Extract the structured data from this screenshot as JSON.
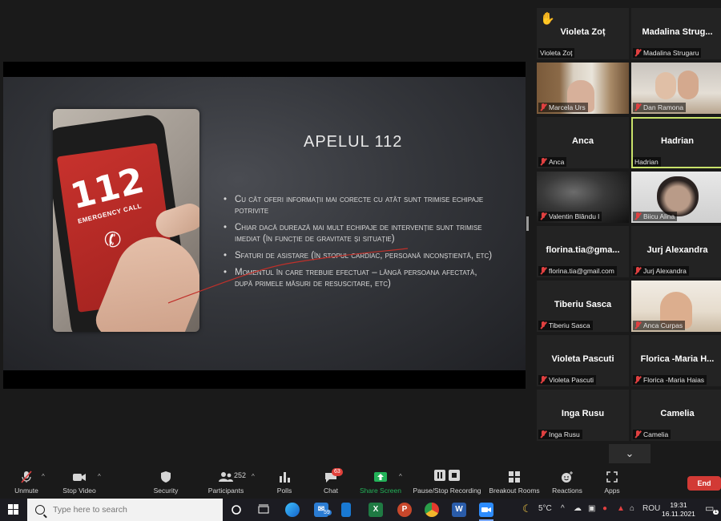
{
  "slide": {
    "title": "APELUL 112",
    "bullets": [
      "Cu cât oferi informații mai corecte cu atât sunt trimise echipaje potrivite",
      "Chiar dacă durează mai mult echipaje de intervenție sunt trimise imediat (în funcție de gravitate și situație)",
      "Sfaturi de asistare (în stopul cardiac, persoană inconștientă, etc)",
      "Momentul în care trebuie efectuat – lângă persoana afectată, după primele măsuri de resuscitare, etc)"
    ],
    "phone_number": "112",
    "phone_label": "EMERGENCY CALL"
  },
  "gallery": {
    "tiles": [
      {
        "name": "Violeta Zoț",
        "label": "Violeta Zoț",
        "muted": false,
        "hand_raised": true
      },
      {
        "name": "Madalina  Strug...",
        "label": "Madalina Strugaru",
        "muted": true
      },
      {
        "name": "",
        "label": "Marcela Urs",
        "muted": true,
        "video": true
      },
      {
        "name": "",
        "label": "Dan Ramona",
        "muted": true,
        "video": true
      },
      {
        "name": "Anca",
        "label": "Anca",
        "muted": true
      },
      {
        "name": "Hadrian",
        "label": "Hadrian",
        "muted": false,
        "active": true
      },
      {
        "name": "",
        "label": "Valentin Blându l",
        "muted": true,
        "video": true
      },
      {
        "name": "",
        "label": "Biicu Alina",
        "muted": true,
        "video": true
      },
      {
        "name": "florina.tia@gma...",
        "label": "florina.tia@gmail.com",
        "muted": true
      },
      {
        "name": "Jurj Alexandra",
        "label": "Jurj Alexandra",
        "muted": true
      },
      {
        "name": "Tiberiu Sasca",
        "label": "Tiberiu Sasca",
        "muted": true
      },
      {
        "name": "",
        "label": "Anca Curpas",
        "muted": true,
        "video": true
      },
      {
        "name": "Violeta Pascuti",
        "label": "Violeta Pascuti",
        "muted": true
      },
      {
        "name": "Florica  -Maria  H...",
        "label": "Florica -Maria Haias",
        "muted": true
      },
      {
        "name": "Inga Rusu",
        "label": "Inga Rusu",
        "muted": true
      },
      {
        "name": "Camelia",
        "label": "Camelia",
        "muted": true
      }
    ]
  },
  "toolbar": {
    "unmute": "Unmute",
    "stop_video": "Stop Video",
    "security": "Security",
    "participants": "Participants",
    "participants_count": "252",
    "polls": "Polls",
    "chat": "Chat",
    "chat_badge": "63",
    "share_screen": "Share Screen",
    "recording": "Pause/Stop Recording",
    "breakout": "Breakout Rooms",
    "reactions": "Reactions",
    "apps": "Apps",
    "end": "End"
  },
  "taskbar": {
    "search_placeholder": "Type here to search",
    "mail_badge": "59",
    "weather": "5°C",
    "language": "ROU",
    "time": "19:31",
    "date": "16.11.2021",
    "notification_count": "1"
  },
  "colors": {
    "accent_green": "#23b359",
    "end_red": "#d23a35",
    "active_speaker": "#c9e26a",
    "muted_red": "#e04040"
  }
}
